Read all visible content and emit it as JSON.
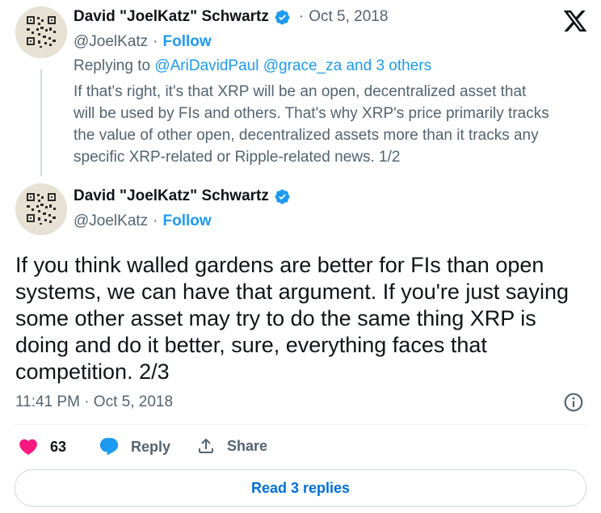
{
  "first_tweet": {
    "author_name": "David \"JoelKatz\" Schwartz",
    "separator": "·",
    "date": "Oct 5, 2018",
    "handle": "@JoelKatz",
    "dot": "·",
    "follow_label": "Follow",
    "replying_prefix": "Replying to",
    "replying_to": "@AriDavidPaul @grace_za and 3 others",
    "text_lines": [
      "If that's right, it's that XRP will be an open, decentralized asset that",
      "will be used by FIs and others. That's why XRP's price primarily tracks",
      "the value of other open, decentralized assets more than it tracks any",
      "specific XRP-related or Ripple-related news. 1/2"
    ]
  },
  "main_tweet": {
    "author_name": "David \"JoelKatz\" Schwartz",
    "handle": "@JoelKatz",
    "dot": "·",
    "follow_label": "Follow",
    "text_lines": [
      "If you think walled gardens are better for FIs than open",
      "systems, we can have that argument. If you're just saying",
      "some other asset may try to do the same thing XRP is",
      "doing and do it better, sure, everything faces that",
      "competition. 2/3"
    ],
    "timestamp": "11:41 PM · Oct 5, 2018"
  },
  "actions": {
    "like_count": "63",
    "reply_label": "Reply",
    "share_label": "Share"
  },
  "read_replies_label": "Read 3 replies",
  "colors": {
    "accent": "#1d9bf0",
    "like": "#f91880",
    "muted": "#536471",
    "text": "#0f1419"
  },
  "icons": [
    "x-logo-icon",
    "verified-badge-icon",
    "info-icon",
    "heart-icon",
    "reply-bubble-icon",
    "share-icon"
  ]
}
